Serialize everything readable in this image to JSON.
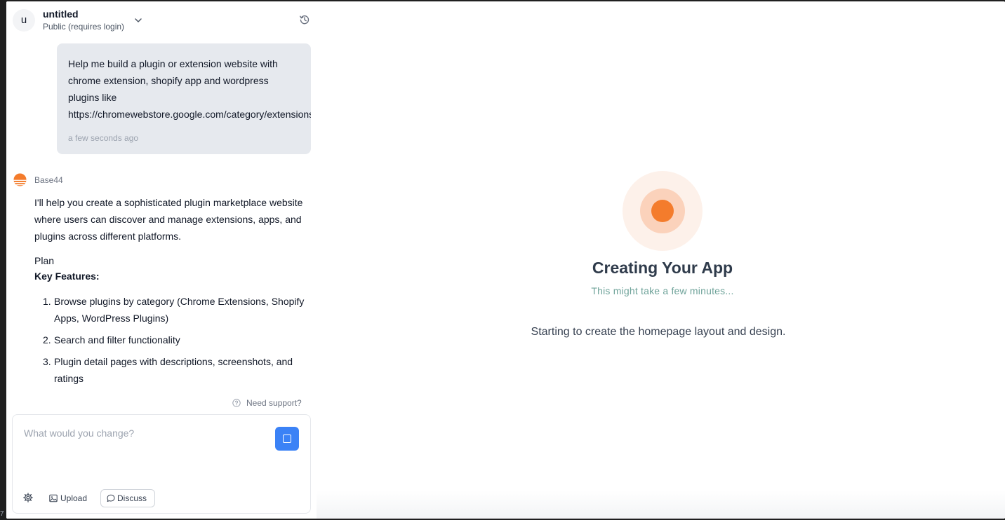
{
  "edge_number": "7",
  "header": {
    "avatar_letter": "u",
    "project_title": "untitled",
    "visibility": "Public (requires login)",
    "icons": {
      "dropdown": "chevron-down-icon",
      "history": "history-icon"
    }
  },
  "user_message": {
    "lines": [
      "Help me build a plugin or extension website with",
      "chrome extension, shopify app and wordpress",
      "plugins like",
      "https://chromewebstore.google.com/category/extensions"
    ],
    "time": "a few seconds ago"
  },
  "assistant": {
    "name": "Base44",
    "intro": "I'll help you create a sophisticated plugin marketplace website where users can discover and manage extensions, apps, and plugins across different platforms.",
    "plan_label": "Plan",
    "key_features_label": "Key Features:",
    "features": [
      {
        "num": "1.",
        "text": "Browse plugins by category (Chrome Extensions, Shopify Apps, WordPress Plugins)"
      },
      {
        "num": "2.",
        "text": "Search and filter functionality"
      },
      {
        "num": "3.",
        "text": "Plugin detail pages with descriptions, screenshots, and ratings"
      }
    ]
  },
  "support_label": "Need support?",
  "composer": {
    "placeholder": "What would you change?",
    "upload_label": "Upload",
    "discuss_label": "Discuss",
    "icons": {
      "settings": "gear-icon",
      "upload": "image-icon",
      "discuss": "chat-bubble-icon",
      "send": "stop-square-icon"
    }
  },
  "preview": {
    "title": "Creating Your App",
    "subtitle": "This might take a few minutes...",
    "status": "Starting to create the homepage layout and design."
  },
  "colors": {
    "accent_blue": "#3b82f6",
    "brand_orange": "#f47c2c",
    "subtitle_teal": "#6fa39a",
    "bubble_bg": "#e6e9ee"
  }
}
